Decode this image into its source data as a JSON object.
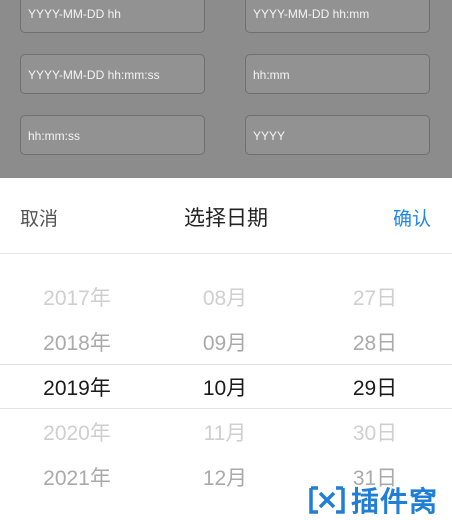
{
  "form_fields": [
    {
      "placeholder": "YYYY-MM-DD hh"
    },
    {
      "placeholder": "YYYY-MM-DD hh:mm"
    },
    {
      "placeholder": "YYYY-MM-DD hh:mm:ss"
    },
    {
      "placeholder": "hh:mm"
    },
    {
      "placeholder": "hh:mm:ss"
    },
    {
      "placeholder": "YYYY"
    }
  ],
  "picker": {
    "cancel_label": "取消",
    "title": "选择日期",
    "confirm_label": "确认",
    "years": [
      "2017年",
      "2018年",
      "2019年",
      "2020年",
      "2021年"
    ],
    "months": [
      "08月",
      "09月",
      "10月",
      "11月",
      "12月"
    ],
    "days": [
      "27日",
      "28日",
      "29日",
      "30日",
      "31日"
    ],
    "selected": {
      "year": "2019年",
      "month": "10月",
      "day": "29日"
    }
  },
  "watermark": {
    "text": "插件窝"
  },
  "colors": {
    "accent": "#1e88e5",
    "overlay": "#8c8c8c",
    "watermark": "#1f7ed6"
  }
}
